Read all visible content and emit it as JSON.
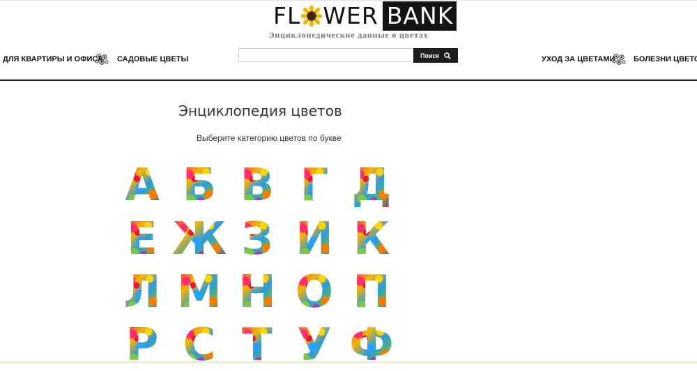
{
  "logo": {
    "part1": "FL",
    "part2": "WER",
    "part3": "BANK",
    "tagline": "Энциклопедические данные о цветах"
  },
  "nav": {
    "left": [
      "ДЛЯ КВАРТИРЫ И ОФИСА",
      "САДОВЫЕ ЦВЕТЫ"
    ],
    "right": [
      "УХОД ЗА ЦВЕТАМИ",
      "БОЛЕЗНИ ЦВЕТОВ"
    ]
  },
  "search": {
    "value": "",
    "button_label": "Поиск"
  },
  "main": {
    "title": "Энциклопедия цветов",
    "subtitle": "Выберите категорию цветов по букве"
  },
  "letters": [
    "А",
    "Б",
    "В",
    "Г",
    "Д",
    "Е",
    "Ж",
    "З",
    "И",
    "К",
    "Л",
    "М",
    "Н",
    "О",
    "П",
    "Р",
    "С",
    "Т",
    "У",
    "Ф"
  ],
  "colors": {
    "logo_text": "#111111",
    "logo_bank_bg": "#141414",
    "header_rule": "#1a1a1a",
    "search_button_bg": "#1d1d1d"
  }
}
